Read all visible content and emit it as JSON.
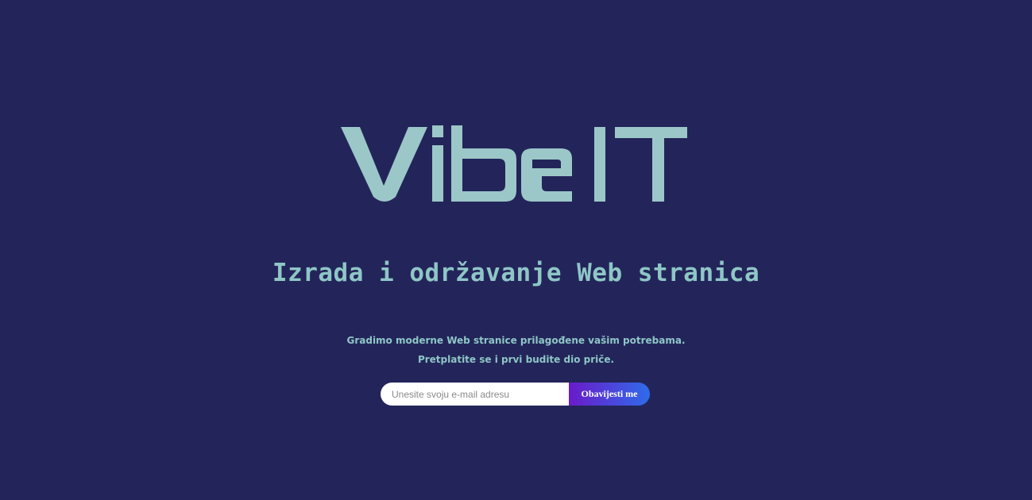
{
  "brand": {
    "logo_text": "VibeIT",
    "color": "#9cc7c8"
  },
  "hero": {
    "subtitle": "Izrada i održavanje Web stranica",
    "tagline_1": "Gradimo moderne Web stranice prilagođene vašim potrebama.",
    "tagline_2": "Pretplatite se i prvi budite dio priče."
  },
  "subscribe": {
    "email_placeholder": "Unesite svoju e-mail adresu",
    "email_value": "",
    "button_label": "Obavijesti me"
  },
  "colors": {
    "background": "#23255a",
    "text_accent": "#8fc6c6",
    "button_gradient_start": "#6a1bc9",
    "button_gradient_end": "#2f6bea"
  }
}
